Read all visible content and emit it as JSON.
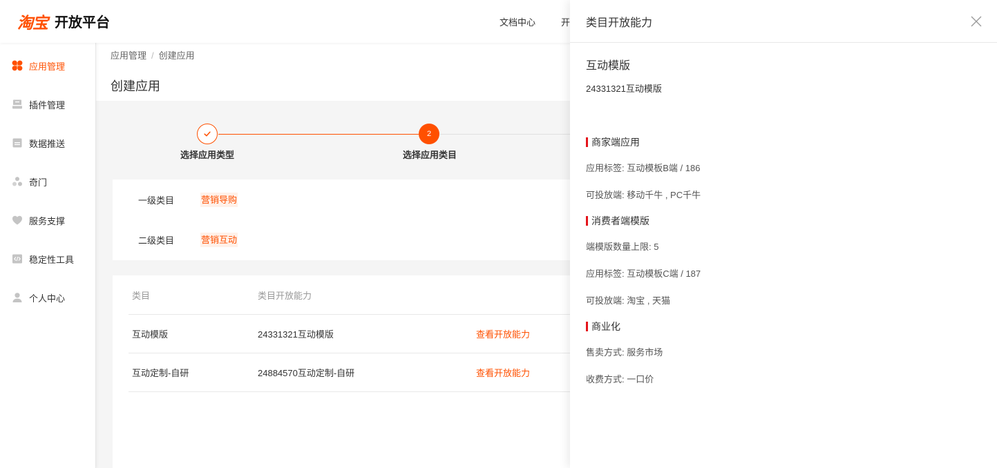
{
  "header": {
    "logo_mark": "淘宝",
    "logo_text": "开放平台",
    "nav": [
      {
        "label": "文档中心"
      },
      {
        "label": "开"
      }
    ]
  },
  "sidebar": {
    "items": [
      {
        "label": "应用管理",
        "icon": "app-grid-icon",
        "active": true
      },
      {
        "label": "插件管理",
        "icon": "plugin-icon",
        "active": false
      },
      {
        "label": "数据推送",
        "icon": "data-push-icon",
        "active": false
      },
      {
        "label": "奇门",
        "icon": "qimen-icon",
        "active": false
      },
      {
        "label": "服务支撑",
        "icon": "heart-icon",
        "active": false
      },
      {
        "label": "稳定性工具",
        "icon": "code-icon",
        "active": false
      },
      {
        "label": "个人中心",
        "icon": "user-icon",
        "active": false
      }
    ]
  },
  "breadcrumb": {
    "items": [
      "应用管理",
      "创建应用"
    ],
    "separator": "/"
  },
  "page_title": "创建应用",
  "steps": [
    {
      "label": "选择应用类型",
      "completed": true
    },
    {
      "label": "选择应用类目",
      "completed": false,
      "number": "2"
    }
  ],
  "category": {
    "rows": [
      {
        "label": "一级类目",
        "value": "营销导购"
      },
      {
        "label": "二级类目",
        "value": "营销互动"
      }
    ]
  },
  "table": {
    "columns": [
      "类目",
      "类目开放能力"
    ],
    "rows": [
      {
        "category": "互动模版",
        "ability": "24331321互动模版",
        "action": "查看开放能力"
      },
      {
        "category": "互动定制-自研",
        "ability": "24884570互动定制-自研",
        "action": "查看开放能力"
      }
    ]
  },
  "drawer": {
    "title": "类目开放能力",
    "close_icon": "close-icon",
    "name": "互动模版",
    "subtitle": "24331321互动模版",
    "sections": [
      {
        "title": "商家端应用",
        "lines": [
          "应用标签: 互动模板B端 / 186",
          "可投放端: 移动千牛 , PC千牛"
        ]
      },
      {
        "title": "消费者端模版",
        "lines": [
          "端模版数量上限: 5",
          "应用标签: 互动模板C端 / 187",
          "可投放端: 淘宝 , 天猫"
        ]
      },
      {
        "title": "商业化",
        "lines": [
          "售卖方式: 服务市场",
          "收费方式: 一口价"
        ]
      }
    ]
  },
  "colors": {
    "brand": "#ff5000",
    "section_bar": "#e4141b",
    "tag_bg": "#fff1e9"
  }
}
